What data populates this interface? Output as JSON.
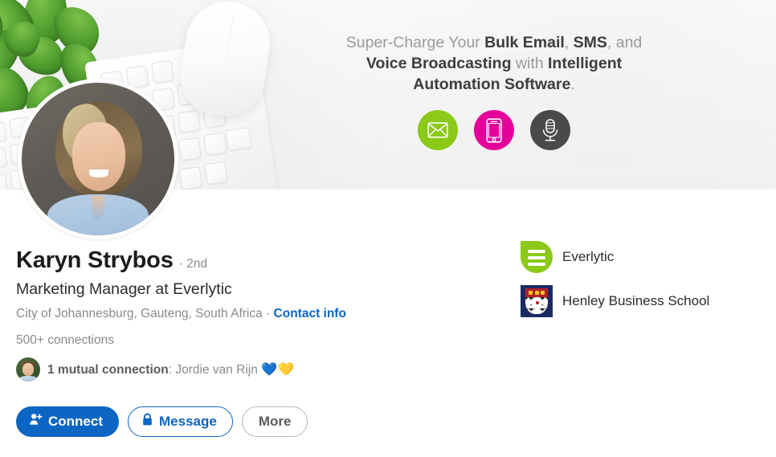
{
  "banner": {
    "promo_lines": [
      [
        {
          "text": "Super-Charge Your ",
          "bold": false
        },
        {
          "text": "Bulk Email",
          "bold": true
        },
        {
          "text": ", ",
          "bold": false
        },
        {
          "text": "SMS",
          "bold": true
        },
        {
          "text": ", and",
          "bold": false
        }
      ],
      [
        {
          "text": "Voice Broadcasting",
          "bold": true
        },
        {
          "text": " with ",
          "bold": false
        },
        {
          "text": "Intelligent",
          "bold": true
        }
      ],
      [
        {
          "text": "Automation Software",
          "bold": true
        },
        {
          "text": ".",
          "bold": false
        }
      ]
    ],
    "promo_text_plain": "Super-Charge Your Bulk Email, SMS, and Voice Broadcasting with Intelligent Automation Software.",
    "icons": [
      {
        "name": "email-icon",
        "glyph": "✉",
        "color": "#8CC919"
      },
      {
        "name": "sms-phone-icon",
        "glyph": "▯",
        "color": "#E5009B"
      },
      {
        "name": "voice-microphone-icon",
        "glyph": "Ἲ4",
        "color": "#4A4A4A"
      }
    ]
  },
  "profile": {
    "photo_alt": "Karyn Strybos profile photo",
    "name": "Karyn Strybos",
    "degree": "· 2nd",
    "headline": "Marketing Manager at Everlytic",
    "location": "City of Johannesburg, Gauteng, South Africa",
    "location_separator": " · ",
    "contact_info_label": "Contact info",
    "connections": "500+ connections",
    "mutual": {
      "prefix": "1 mutual connection",
      "colon": ": ",
      "person": "Jordie van Rijn",
      "emoji_blue_heart": "💙",
      "emoji_yellow_heart": "💛"
    }
  },
  "actions": {
    "connect_label": "Connect",
    "message_label": "Message",
    "more_label": "More"
  },
  "organizations": [
    {
      "name": "Everlytic",
      "logo": "everlytic-logo"
    },
    {
      "name": "Henley Business School",
      "logo": "henley-business-school-logo"
    }
  ],
  "colors": {
    "linkedin_blue": "#0A66C2",
    "everlytic_green": "#8CC919",
    "sms_magenta": "#E5009B",
    "voice_gray": "#4A4A4A",
    "henley_navy": "#1C2A63"
  }
}
